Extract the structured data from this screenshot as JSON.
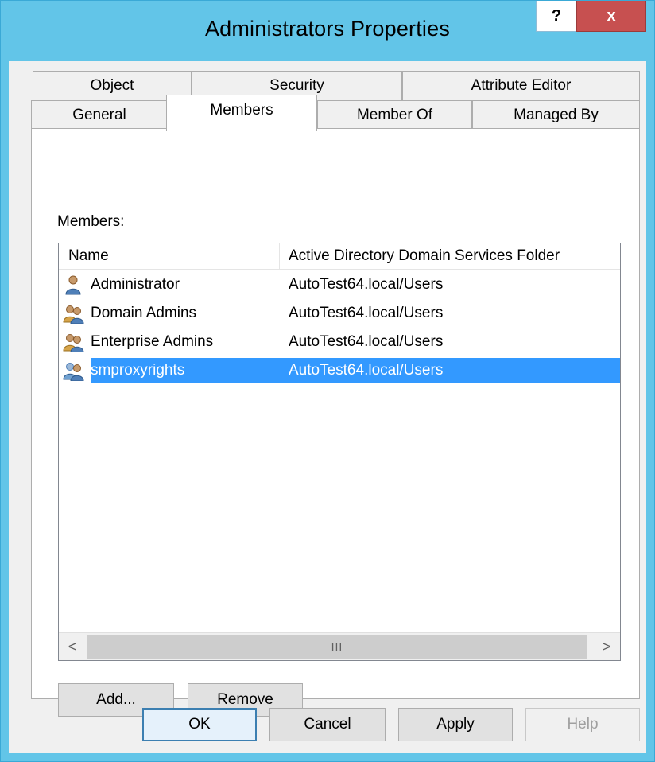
{
  "window": {
    "title": "Administrators Properties",
    "help_label": "?",
    "close_label": "x"
  },
  "tabs": {
    "row1": [
      "Object",
      "Security",
      "Attribute Editor"
    ],
    "row2": [
      "General",
      "Members",
      "Member Of",
      "Managed By"
    ],
    "active": "Members"
  },
  "members": {
    "label": "Members:",
    "columns": [
      "Name",
      "Active Directory Domain Services Folder"
    ],
    "rows": [
      {
        "name": "Administrator",
        "folder": "AutoTest64.local/Users",
        "icon": "user-icon"
      },
      {
        "name": "Domain Admins",
        "folder": "AutoTest64.local/Users",
        "icon": "group-icon"
      },
      {
        "name": "Enterprise Admins",
        "folder": "AutoTest64.local/Users",
        "icon": "group-icon"
      },
      {
        "name": "smproxyrights",
        "folder": "AutoTest64.local/Users",
        "icon": "group-icon",
        "selected": true
      }
    ],
    "scroll_left": "<",
    "scroll_right": ">",
    "scroll_grip": "III"
  },
  "actions": {
    "add": "Add...",
    "remove": "Remove"
  },
  "footer": {
    "ok": "OK",
    "cancel": "Cancel",
    "apply": "Apply",
    "help": "Help"
  },
  "colors": {
    "titlebar": "#62c5e8",
    "close": "#c75050",
    "selection": "#3399ff"
  }
}
